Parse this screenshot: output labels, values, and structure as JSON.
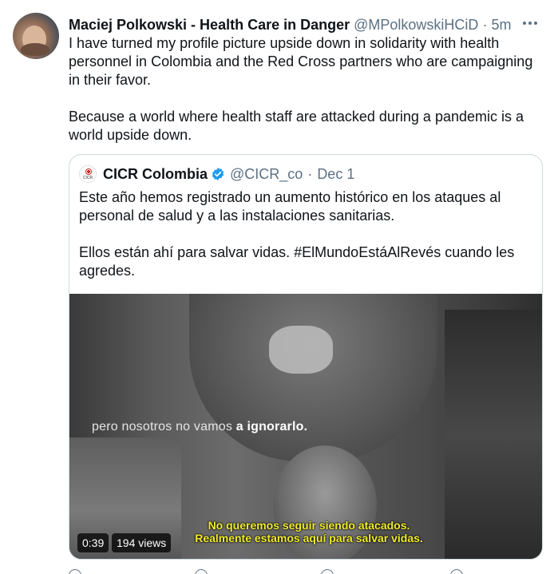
{
  "tweet": {
    "author_name": "Maciej Polkowski - Health Care in Danger",
    "author_handle": "@MPolkowskiHCiD",
    "separator": "·",
    "time": "5m",
    "paragraph_1": "I have turned my profile picture upside down in solidarity with health personnel in Colombia and the Red Cross partners who are campaigning in their favor.",
    "paragraph_2": "Because a world where health staff are attacked during a pandemic is a world upside down."
  },
  "quoted": {
    "logo_abbr": "CICR",
    "name": "CICR Colombia",
    "handle": "@CICR_co",
    "separator": "·",
    "date": "Dec 1",
    "paragraph_1": "Este año hemos registrado un aumento histórico en los ataques al personal de salud y a las instalaciones sanitarias.",
    "paragraph_2": "Ellos están ahí para salvar vidas. #ElMundoEstáAlRevés cuando les agredes."
  },
  "video": {
    "caption_top_plain": "pero nosotros no vamos ",
    "caption_top_bold": "a ignorarlo.",
    "caption_bottom_line1": "No queremos seguir siendo atacados.",
    "caption_bottom_line2": "Realmente estamos aquí para salvar vidas.",
    "duration": "0:39",
    "views": "194 views"
  },
  "colors": {
    "text_primary": "#0f1419",
    "text_secondary": "#5b7083",
    "border": "#cfd9de",
    "verified": "#1d9bf0",
    "caption_yellow": "#f2ee2a"
  }
}
